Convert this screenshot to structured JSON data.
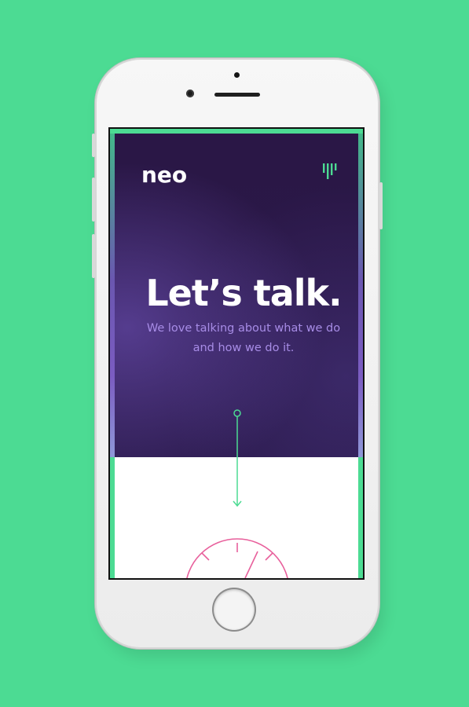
{
  "brand": {
    "logo_text": "neo"
  },
  "hero": {
    "headline": "Let’s talk.",
    "subtext": "We love talking about what we do and how we do it."
  },
  "icons": {
    "menu": "menu-bars-icon",
    "scroll": "scroll-down-arrow-icon",
    "gauge": "speedometer-gauge-icon"
  },
  "colors": {
    "background": "#4cdb93",
    "hero_bg": "#2a1746",
    "accent_green": "#4cdb93",
    "subtext_purple": "#a78ce6",
    "gauge_pink": "#e8609c"
  }
}
